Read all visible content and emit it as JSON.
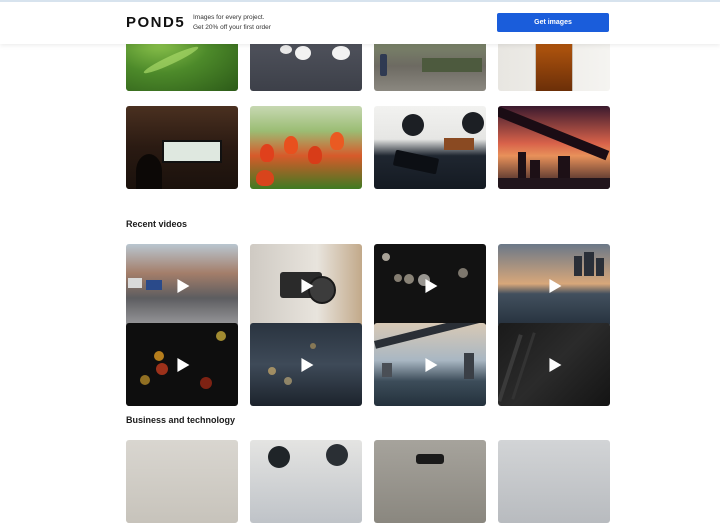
{
  "header": {
    "logo": "POND5",
    "tagline_line1": "Images for every project.",
    "tagline_line2": "Get 20% off your first order",
    "cta_label": "Get images",
    "accent_color": "#1a5ddb"
  },
  "sections": {
    "recent_videos": {
      "title": "Recent videos"
    },
    "business": {
      "title": "Business and technology"
    }
  },
  "icons": {
    "play": "play-icon"
  }
}
